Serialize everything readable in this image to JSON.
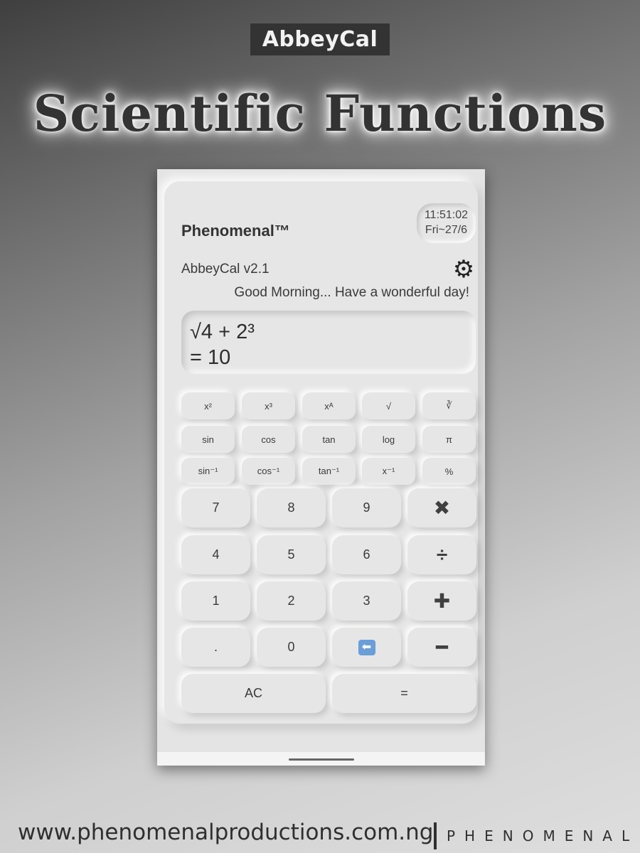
{
  "poster": {
    "brand": "AbbeyCal",
    "headline": "Scientific Functions",
    "website": "www.phenomenalproductions.com.ng",
    "studio_logo": "PHENOMENAL"
  },
  "app": {
    "name": "Phenomenal™",
    "time": "11:51:02",
    "date": "Fri~27/6",
    "version": "AbbeyCal v2.1",
    "settings_icon": "gear-icon",
    "greeting": "Good Morning... Have a wonderful day!",
    "expression": "√4 + 2³",
    "result": "= 10"
  },
  "scientific_keys": [
    [
      "x²",
      "x³",
      "xᴬ",
      "√",
      "∛"
    ],
    [
      "sin",
      "cos",
      "tan",
      "log",
      "π"
    ],
    [
      "sin⁻¹",
      "cos⁻¹",
      "tan⁻¹",
      "x⁻¹",
      "%"
    ]
  ],
  "keypad": {
    "row1": [
      "7",
      "8",
      "9",
      "✖"
    ],
    "row2": [
      "4",
      "5",
      "6",
      "÷"
    ],
    "row3": [
      "1",
      "2",
      "3",
      "✚"
    ],
    "row4": [
      ".",
      "0",
      "⬅",
      "━"
    ],
    "clear": "AC",
    "equals": "="
  },
  "colors": {
    "backspace_icon": "#6a9ed8",
    "surface": "#e6e6e6",
    "text": "#3a3a3a"
  }
}
